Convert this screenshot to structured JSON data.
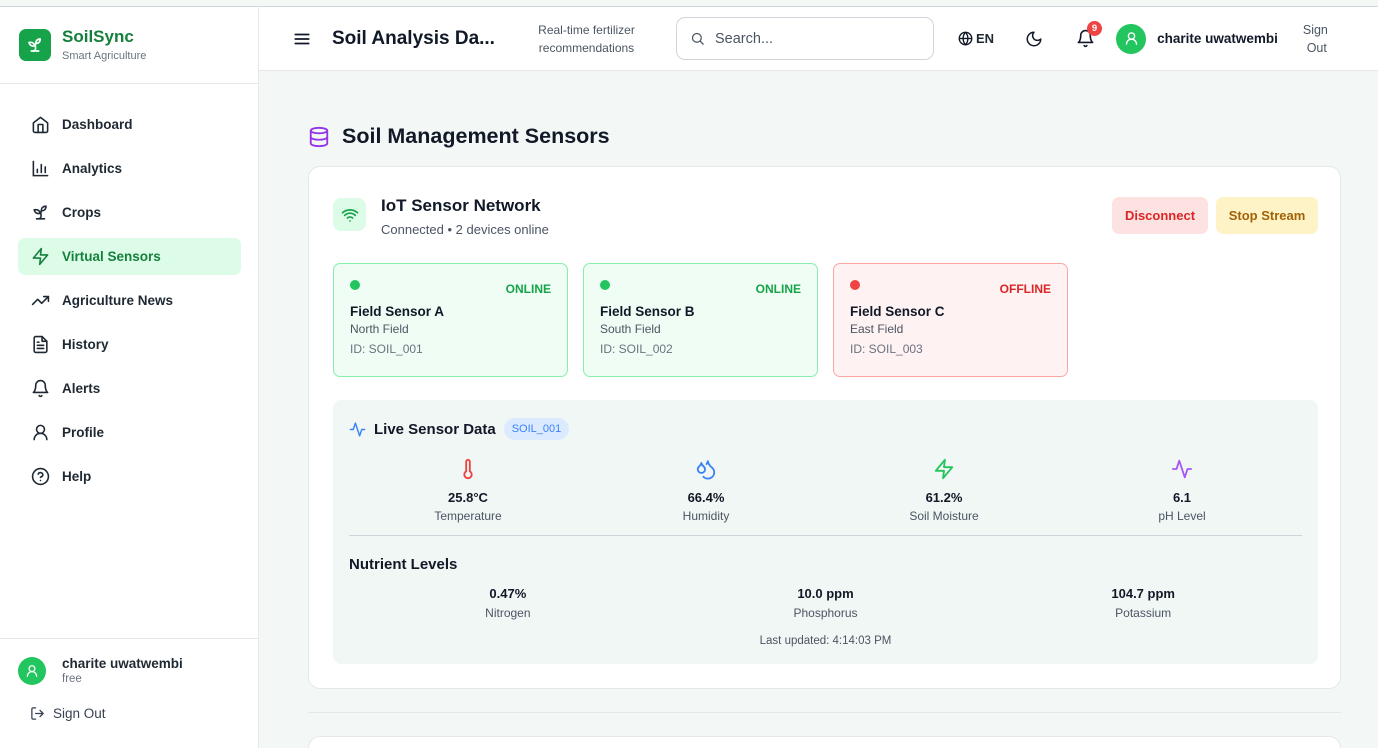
{
  "brand": {
    "name": "SoilSync",
    "subtitle": "Smart Agriculture"
  },
  "sidebar": {
    "items": [
      {
        "label": "Dashboard",
        "icon": "home-icon"
      },
      {
        "label": "Analytics",
        "icon": "bar-chart-icon"
      },
      {
        "label": "Crops",
        "icon": "sprout-icon"
      },
      {
        "label": "Virtual Sensors",
        "icon": "zap-icon",
        "active": true
      },
      {
        "label": "Agriculture News",
        "icon": "trending-up-icon"
      },
      {
        "label": "History",
        "icon": "file-text-icon"
      },
      {
        "label": "Alerts",
        "icon": "bell-icon"
      },
      {
        "label": "Profile",
        "icon": "user-icon"
      },
      {
        "label": "Help",
        "icon": "help-circle-icon"
      }
    ],
    "user": {
      "name": "charite uwatwembi",
      "plan": "free"
    },
    "sign_out": "Sign Out"
  },
  "header": {
    "title": "Soil Analysis Da...",
    "subtitle": "Real-time fertilizer recommendations",
    "search_placeholder": "Search...",
    "language": "EN",
    "notification_count": "9",
    "user_name": "charite uwatwembi",
    "sign_out": "Sign Out"
  },
  "main": {
    "page_title": "Soil Management Sensors",
    "network": {
      "title": "IoT Sensor Network",
      "status": "Connected • 2 devices online",
      "disconnect_label": "Disconnect",
      "stop_stream_label": "Stop Stream"
    },
    "sensors": [
      {
        "name": "Field Sensor A",
        "location": "North Field",
        "id": "ID: SOIL_001",
        "status": "ONLINE"
      },
      {
        "name": "Field Sensor B",
        "location": "South Field",
        "id": "ID: SOIL_002",
        "status": "ONLINE"
      },
      {
        "name": "Field Sensor C",
        "location": "East Field",
        "id": "ID: SOIL_003",
        "status": "OFFLINE"
      }
    ],
    "live": {
      "title": "Live Sensor Data",
      "badge": "SOIL_001",
      "metrics": [
        {
          "value": "25.8°C",
          "label": "Temperature",
          "icon": "thermometer-icon",
          "color": "#ef4444"
        },
        {
          "value": "66.4%",
          "label": "Humidity",
          "icon": "droplets-icon",
          "color": "#3b82f6"
        },
        {
          "value": "61.2%",
          "label": "Soil Moisture",
          "icon": "zap-icon",
          "color": "#22c55e"
        },
        {
          "value": "6.1",
          "label": "pH Level",
          "icon": "activity-icon",
          "color": "#a855f7"
        }
      ],
      "nutrients_title": "Nutrient Levels",
      "nutrients": [
        {
          "value": "0.47%",
          "label": "Nitrogen"
        },
        {
          "value": "10.0 ppm",
          "label": "Phosphorus"
        },
        {
          "value": "104.7 ppm",
          "label": "Potassium"
        }
      ],
      "last_updated": "Last updated: 4:14:03 PM"
    }
  },
  "colors": {
    "brand": "#16a34a",
    "active_bg": "#dcfce7",
    "accent_purple": "#9333ea"
  }
}
